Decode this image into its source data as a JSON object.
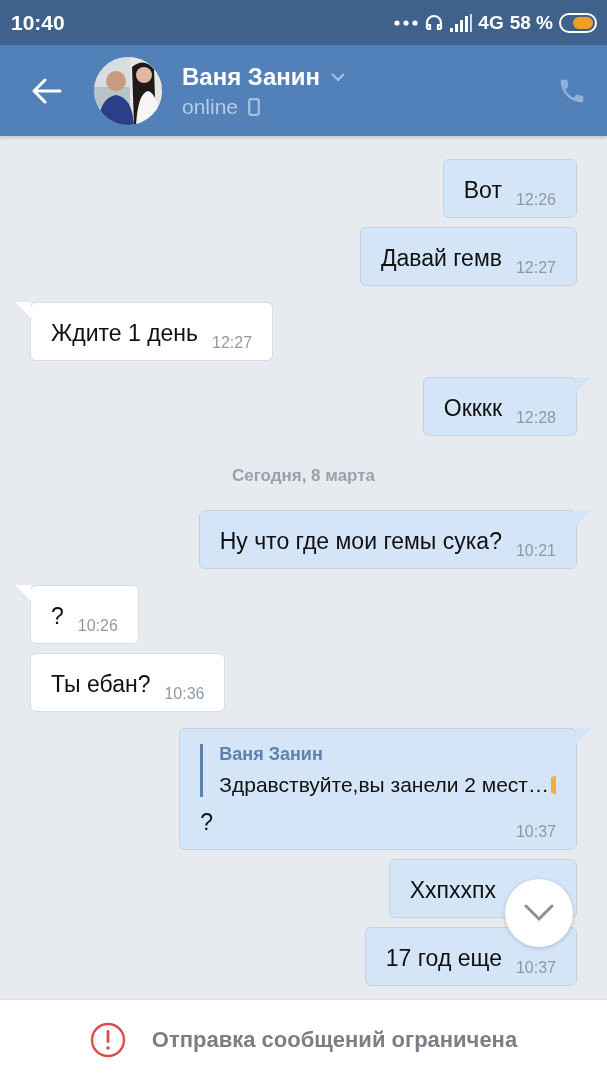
{
  "status_bar": {
    "time": "10:40",
    "network": "4G",
    "battery": "58 %"
  },
  "header": {
    "name": "Ваня Занин",
    "presence": "online"
  },
  "messages": [
    {
      "kind": "outgoing",
      "tail": false,
      "text": "Вот",
      "time": "12:26"
    },
    {
      "kind": "outgoing",
      "tail": false,
      "text": "Давай гемв",
      "time": "12:27"
    },
    {
      "kind": "incoming",
      "tail": true,
      "text": "Ждите 1 день",
      "time": "12:27"
    },
    {
      "kind": "outgoing",
      "tail": true,
      "text": "Окккк",
      "time": "12:28"
    },
    {
      "kind": "date",
      "text": "Сегодня, 8 марта"
    },
    {
      "kind": "outgoing",
      "tail": true,
      "text": "Ну что где мои гемы сука?",
      "time": "10:21"
    },
    {
      "kind": "incoming",
      "tail": true,
      "text": "?",
      "time": "10:26"
    },
    {
      "kind": "incoming",
      "tail": false,
      "text": "Ты ебан?",
      "time": "10:36"
    },
    {
      "kind": "reply",
      "tail": true,
      "quote_author": "Ваня Занин",
      "quote_text": "Здравствуйте,вы занели 2 мест…",
      "text": "?",
      "time": "10:37"
    },
    {
      "kind": "outgoing",
      "tail": false,
      "text": "Xxпxxпx"
    },
    {
      "kind": "outgoing",
      "tail": false,
      "text": "17 год еще",
      "time": "10:37"
    }
  ],
  "footer": {
    "notice": "Отправка сообщений ограничена"
  }
}
